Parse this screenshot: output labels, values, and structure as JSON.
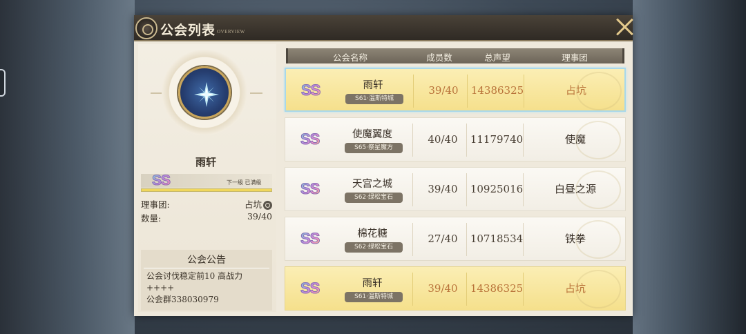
{
  "header": {
    "title": "公会列表",
    "subtitle": "OVERVIEW"
  },
  "selected_guild": {
    "name": "雨轩",
    "rank": "SS",
    "level_text": "下一级 已满级",
    "level_progress": 1.0,
    "council_label": "理事团:",
    "council_value": "占坑",
    "count_label": "数量:",
    "count_value": "39/40"
  },
  "notice": {
    "title": "公会公告",
    "body": "公会讨伐稳定前10 高战力\n++++\n公会群338030979"
  },
  "table": {
    "headers": {
      "name": "公会名称",
      "members": "成员数",
      "prestige": "总声望",
      "council": "理事团"
    },
    "rows": [
      {
        "rank": "SS",
        "name": "雨轩",
        "server": "S61·温斯特城",
        "members": "39/40",
        "prestige": "14386325",
        "council": "占坑"
      },
      {
        "rank": "SS",
        "name": "使魔翼度",
        "server": "S65·祭星魔方",
        "members": "40/40",
        "prestige": "11179740",
        "council": "使魔"
      },
      {
        "rank": "SS",
        "name": "天宫之城",
        "server": "S62·绿松宝石",
        "members": "39/40",
        "prestige": "10925016",
        "council": "白昼之源"
      },
      {
        "rank": "SS",
        "name": "棉花糖",
        "server": "S62·绿松宝石",
        "members": "27/40",
        "prestige": "10718534",
        "council": "铁拳"
      }
    ],
    "my_guild": {
      "rank": "SS",
      "name": "雨轩",
      "server": "S61·温斯特城",
      "members": "39/40",
      "prestige": "14386325",
      "council": "占坑"
    }
  },
  "colors": {
    "highlight": "#f5e08c",
    "panel": "#efe9dc",
    "header": "#2f2a24",
    "accent_text": "#b9733a"
  }
}
